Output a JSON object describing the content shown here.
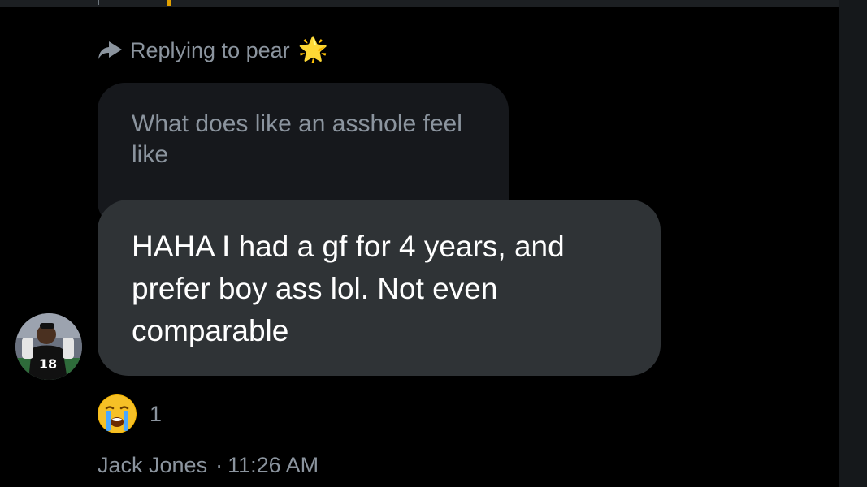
{
  "reply": {
    "prefix": "Replying to pear",
    "star_emoji": "🌟"
  },
  "quoted_message": {
    "text": "What does like an asshole feel like"
  },
  "message": {
    "text": "HAHA I had a gf for 4 years, and prefer boy ass lol. Not even comparable"
  },
  "avatar": {
    "jersey_number": "18"
  },
  "reaction": {
    "emoji_name": "crying-face-icon",
    "count": "1"
  },
  "meta": {
    "sender": "Jack Jones",
    "separator": "·",
    "time": "11:26 AM"
  },
  "colors": {
    "background": "#000000",
    "main_bubble": "#2f3336",
    "quoted_bubble": "#16181c",
    "muted_text": "#8b949e",
    "text": "#ffffff"
  }
}
